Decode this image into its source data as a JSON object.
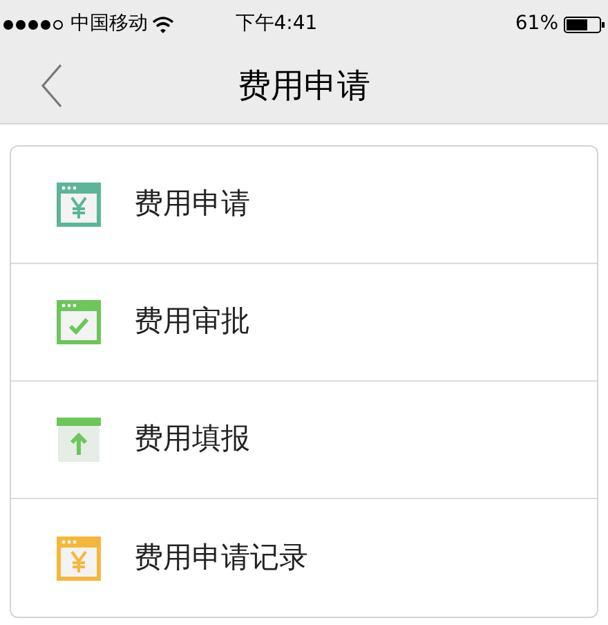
{
  "status_bar": {
    "carrier": "中国移动",
    "time": "下午4:41",
    "battery": "61%"
  },
  "nav_bar": {
    "title": "费用申请"
  },
  "menu": [
    {
      "label": "费用申请",
      "kind": "yen",
      "color": "#5bb598"
    },
    {
      "label": "费用审批",
      "kind": "check",
      "color": "#6cc65a"
    },
    {
      "label": "费用填报",
      "kind": "upload",
      "color": "#6cc65a"
    },
    {
      "label": "费用申请记录",
      "kind": "yen",
      "color": "#f5b73b"
    }
  ]
}
